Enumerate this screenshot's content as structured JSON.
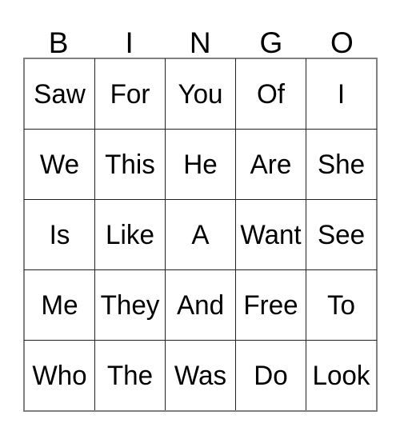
{
  "card": {
    "title": "BINGO",
    "header_letters": [
      "B",
      "I",
      "N",
      "G",
      "O"
    ],
    "columns": 5,
    "rows": 5,
    "colors": {
      "text": "#000000",
      "cell_border": "#222222",
      "outer_border": "#808080",
      "background": "#ffffff"
    },
    "grid": [
      [
        "Saw",
        "For",
        "You",
        "Of",
        "I"
      ],
      [
        "We",
        "This",
        "He",
        "Are",
        "She"
      ],
      [
        "Is",
        "Like",
        "A",
        "Want",
        "See"
      ],
      [
        "Me",
        "They",
        "And",
        "Free",
        "To"
      ],
      [
        "Who",
        "The",
        "Was",
        "Do",
        "Look"
      ]
    ]
  }
}
